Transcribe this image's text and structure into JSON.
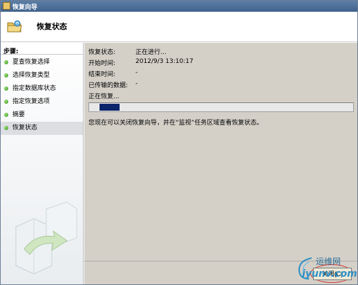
{
  "window": {
    "title": "恢复向导"
  },
  "header": {
    "title": "恢复状态"
  },
  "sidebar": {
    "steps_label": "步骤:",
    "items": [
      {
        "label": "夏查恢复选择"
      },
      {
        "label": "选择恢复类型"
      },
      {
        "label": "指定数据库状态"
      },
      {
        "label": "指定恢复选项"
      },
      {
        "label": "摘要"
      },
      {
        "label": "恢复状态",
        "current": true
      }
    ]
  },
  "status": {
    "fields": [
      {
        "label": "恢复状态:",
        "value": "正在进行..."
      },
      {
        "label": "开始时间:",
        "value": "2012/9/3 13:10:17"
      },
      {
        "label": "结束时间:",
        "value": "-"
      },
      {
        "label": "已传输的数据:",
        "value": "-"
      }
    ],
    "progress_label": "正在恢复...",
    "progress_fraction": 0.08,
    "hint": "您现在可以关闭恢复向导，并在“监视”任务区域查看恢复状态。"
  },
  "footer": {
    "close_label": "关闭(C)"
  },
  "watermark": {
    "cn": "运维网",
    "en": "iyunv.com"
  },
  "colors": {
    "titlebar": "#4a6d96",
    "progress_fill": "#0a246a",
    "content_bg": "#d4d0c8",
    "bullet": "#3c9a22"
  }
}
